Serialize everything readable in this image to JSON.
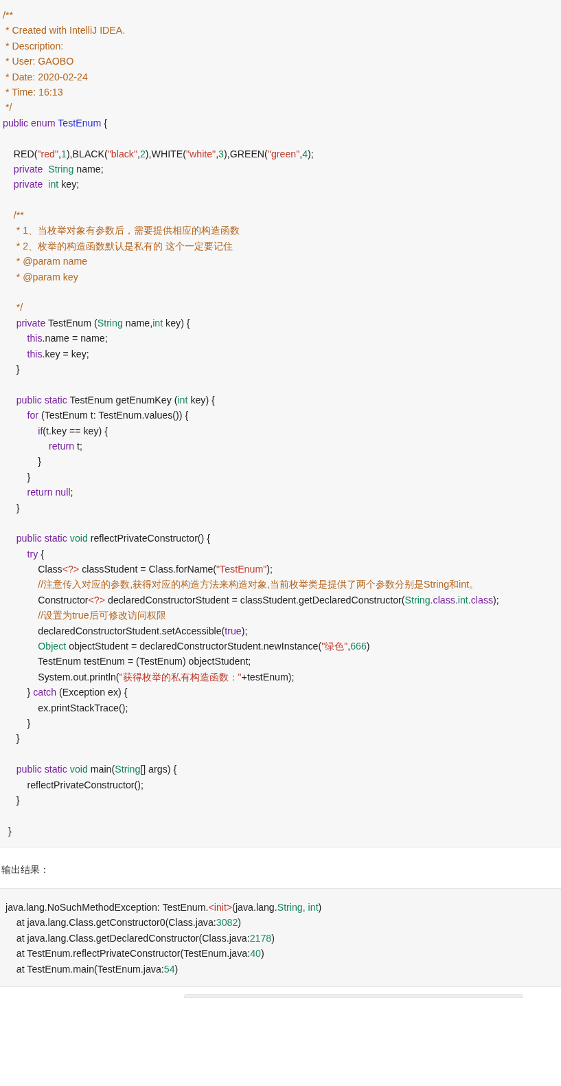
{
  "code_block": {
    "lines": [
      {
        "kind": "code",
        "tokens": [
          {
            "text": "/**",
            "kind": "comment"
          }
        ]
      },
      {
        "kind": "code",
        "tokens": [
          {
            "text": " * Created with IntelliJ IDEA.",
            "kind": "comment"
          }
        ]
      },
      {
        "kind": "code",
        "tokens": [
          {
            "text": " * Description:",
            "kind": "comment"
          }
        ]
      },
      {
        "kind": "code",
        "tokens": [
          {
            "text": " * User: GAOBO",
            "kind": "comment"
          }
        ]
      },
      {
        "kind": "code",
        "tokens": [
          {
            "text": " * Date: 2020-02-24",
            "kind": "comment"
          }
        ]
      },
      {
        "kind": "code",
        "tokens": [
          {
            "text": " * Time: 16:13",
            "kind": "comment"
          }
        ]
      },
      {
        "kind": "code",
        "tokens": [
          {
            "text": " */",
            "kind": "comment"
          }
        ]
      },
      {
        "kind": "code",
        "tokens": [
          {
            "text": "public enum ",
            "kind": "keyword"
          },
          {
            "text": "TestEnum",
            "kind": "title"
          },
          {
            "text": " {",
            "kind": "plain"
          }
        ]
      },
      {
        "kind": "blank"
      },
      {
        "kind": "code",
        "tokens": [
          {
            "text": "    RED(",
            "kind": "plain"
          },
          {
            "text": "\"red\"",
            "kind": "string"
          },
          {
            "text": ",",
            "kind": "plain"
          },
          {
            "text": "1",
            "kind": "number"
          },
          {
            "text": "),BLACK(",
            "kind": "plain"
          },
          {
            "text": "\"black\"",
            "kind": "string"
          },
          {
            "text": ",",
            "kind": "plain"
          },
          {
            "text": "2",
            "kind": "number"
          },
          {
            "text": "),WHITE(",
            "kind": "plain"
          },
          {
            "text": "\"white\"",
            "kind": "string"
          },
          {
            "text": ",",
            "kind": "plain"
          },
          {
            "text": "3",
            "kind": "number"
          },
          {
            "text": "),GREEN(",
            "kind": "plain"
          },
          {
            "text": "\"green\"",
            "kind": "string"
          },
          {
            "text": ",",
            "kind": "plain"
          },
          {
            "text": "4",
            "kind": "number"
          },
          {
            "text": ");",
            "kind": "plain"
          }
        ]
      },
      {
        "kind": "code",
        "tokens": [
          {
            "text": "    private  ",
            "kind": "keyword"
          },
          {
            "text": "String",
            "kind": "type"
          },
          {
            "text": " name;",
            "kind": "plain"
          }
        ]
      },
      {
        "kind": "code",
        "tokens": [
          {
            "text": "    private  ",
            "kind": "keyword"
          },
          {
            "text": "int",
            "kind": "type"
          },
          {
            "text": " key;",
            "kind": "plain"
          }
        ]
      },
      {
        "kind": "blank"
      },
      {
        "kind": "code",
        "tokens": [
          {
            "text": "    /**",
            "kind": "comment"
          }
        ]
      },
      {
        "kind": "code",
        "tokens": [
          {
            "text": "     * 1、当枚举对象有参数后，需要提供相应的构造函数",
            "kind": "comment"
          }
        ]
      },
      {
        "kind": "code",
        "tokens": [
          {
            "text": "     * 2、枚举的构造函数默认是私有的 这个一定要记住",
            "kind": "comment"
          }
        ]
      },
      {
        "kind": "code",
        "tokens": [
          {
            "text": "     * @param name",
            "kind": "comment"
          }
        ]
      },
      {
        "kind": "code",
        "tokens": [
          {
            "text": "     * @param key",
            "kind": "comment"
          }
        ]
      },
      {
        "kind": "blank"
      },
      {
        "kind": "code",
        "tokens": [
          {
            "text": "     */",
            "kind": "comment"
          }
        ]
      },
      {
        "kind": "code",
        "tokens": [
          {
            "text": "     private ",
            "kind": "keyword"
          },
          {
            "text": "TestEnum (",
            "kind": "plain"
          },
          {
            "text": "String",
            "kind": "type"
          },
          {
            "text": " name,",
            "kind": "plain"
          },
          {
            "text": "int",
            "kind": "type"
          },
          {
            "text": " key) {",
            "kind": "plain"
          }
        ]
      },
      {
        "kind": "code",
        "tokens": [
          {
            "text": "         this",
            "kind": "keyword"
          },
          {
            "text": ".name = name;",
            "kind": "plain"
          }
        ]
      },
      {
        "kind": "code",
        "tokens": [
          {
            "text": "         this",
            "kind": "keyword"
          },
          {
            "text": ".key = key;",
            "kind": "plain"
          }
        ]
      },
      {
        "kind": "code",
        "tokens": [
          {
            "text": "     }",
            "kind": "plain"
          }
        ]
      },
      {
        "kind": "blank"
      },
      {
        "kind": "code",
        "tokens": [
          {
            "text": "     public static ",
            "kind": "keyword"
          },
          {
            "text": "TestEnum getEnumKey (",
            "kind": "plain"
          },
          {
            "text": "int",
            "kind": "type"
          },
          {
            "text": " key) {",
            "kind": "plain"
          }
        ]
      },
      {
        "kind": "code",
        "tokens": [
          {
            "text": "         for ",
            "kind": "keyword"
          },
          {
            "text": "(TestEnum t: TestEnum.values()) {",
            "kind": "plain"
          }
        ]
      },
      {
        "kind": "code",
        "tokens": [
          {
            "text": "             if",
            "kind": "keyword"
          },
          {
            "text": "(t.key == key) {",
            "kind": "plain"
          }
        ]
      },
      {
        "kind": "code",
        "tokens": [
          {
            "text": "                 return ",
            "kind": "keyword"
          },
          {
            "text": "t;",
            "kind": "plain"
          }
        ]
      },
      {
        "kind": "code",
        "tokens": [
          {
            "text": "             }",
            "kind": "plain"
          }
        ]
      },
      {
        "kind": "code",
        "tokens": [
          {
            "text": "         }",
            "kind": "plain"
          }
        ]
      },
      {
        "kind": "code",
        "tokens": [
          {
            "text": "         return null",
            "kind": "keyword"
          },
          {
            "text": ";",
            "kind": "plain"
          }
        ]
      },
      {
        "kind": "code",
        "tokens": [
          {
            "text": "     }",
            "kind": "plain"
          }
        ]
      },
      {
        "kind": "blank"
      },
      {
        "kind": "code",
        "tokens": [
          {
            "text": "     public static ",
            "kind": "keyword"
          },
          {
            "text": "void",
            "kind": "type"
          },
          {
            "text": " reflectPrivateConstructor() {",
            "kind": "plain"
          }
        ]
      },
      {
        "kind": "code",
        "tokens": [
          {
            "text": "         try",
            "kind": "keyword"
          },
          {
            "text": " {",
            "kind": "plain"
          }
        ]
      },
      {
        "kind": "code",
        "tokens": [
          {
            "text": "             Class",
            "kind": "plain"
          },
          {
            "text": "<?>",
            "kind": "string"
          },
          {
            "text": " classStudent = Class.forName(",
            "kind": "plain"
          },
          {
            "text": "\"TestEnum\"",
            "kind": "string"
          },
          {
            "text": ");",
            "kind": "plain"
          }
        ]
      },
      {
        "kind": "code",
        "tokens": [
          {
            "text": "             //注意传入对应的参数,获得对应的构造方法来构造对象,当前枚举类是提供了两个参数分别是String和int。",
            "kind": "comment"
          }
        ]
      },
      {
        "kind": "code",
        "tokens": [
          {
            "text": "             Constructor",
            "kind": "plain"
          },
          {
            "text": "<?>",
            "kind": "string"
          },
          {
            "text": " declaredConstructorStudent = classStudent.getDeclaredConstructor(",
            "kind": "plain"
          },
          {
            "text": "String",
            "kind": "type"
          },
          {
            "text": ".class.",
            "kind": "keyword"
          },
          {
            "text": "int",
            "kind": "type"
          },
          {
            "text": ".class",
            "kind": "keyword"
          },
          {
            "text": ");",
            "kind": "plain"
          }
        ]
      },
      {
        "kind": "code",
        "tokens": [
          {
            "text": "             //设置为true后可修改访问权限",
            "kind": "comment"
          }
        ]
      },
      {
        "kind": "code",
        "tokens": [
          {
            "text": "             declaredConstructorStudent.setAccessible(",
            "kind": "plain"
          },
          {
            "text": "true",
            "kind": "keyword"
          },
          {
            "text": ");",
            "kind": "plain"
          }
        ]
      },
      {
        "kind": "code",
        "tokens": [
          {
            "text": "             Object",
            "kind": "type"
          },
          {
            "text": " objectStudent = declaredConstructorStudent.newInstance(",
            "kind": "plain"
          },
          {
            "text": "\"绿色\"",
            "kind": "string"
          },
          {
            "text": ",",
            "kind": "plain"
          },
          {
            "text": "666",
            "kind": "number"
          },
          {
            "text": ")",
            "kind": "plain"
          }
        ]
      },
      {
        "kind": "code",
        "tokens": [
          {
            "text": "             TestEnum testEnum = (TestEnum) objectStudent;",
            "kind": "plain"
          }
        ]
      },
      {
        "kind": "code",
        "tokens": [
          {
            "text": "             System.out.println(",
            "kind": "plain"
          },
          {
            "text": "\"获得枚举的私有构造函数：\"",
            "kind": "string"
          },
          {
            "text": "+testEnum);",
            "kind": "plain"
          }
        ]
      },
      {
        "kind": "code",
        "tokens": [
          {
            "text": "         } ",
            "kind": "plain"
          },
          {
            "text": "catch",
            "kind": "keyword"
          },
          {
            "text": " (Exception ex) {",
            "kind": "plain"
          }
        ]
      },
      {
        "kind": "code",
        "tokens": [
          {
            "text": "             ex.printStackTrace();",
            "kind": "plain"
          }
        ]
      },
      {
        "kind": "code",
        "tokens": [
          {
            "text": "         }",
            "kind": "plain"
          }
        ]
      },
      {
        "kind": "code",
        "tokens": [
          {
            "text": "     }",
            "kind": "plain"
          }
        ]
      },
      {
        "kind": "blank"
      },
      {
        "kind": "code",
        "tokens": [
          {
            "text": "     public static ",
            "kind": "keyword"
          },
          {
            "text": "void",
            "kind": "type"
          },
          {
            "text": " main(",
            "kind": "plain"
          },
          {
            "text": "String",
            "kind": "type"
          },
          {
            "text": "[] args) {",
            "kind": "plain"
          }
        ]
      },
      {
        "kind": "code",
        "tokens": [
          {
            "text": "         reflectPrivateConstructor();",
            "kind": "plain"
          }
        ]
      },
      {
        "kind": "code",
        "tokens": [
          {
            "text": "     }",
            "kind": "plain"
          }
        ]
      },
      {
        "kind": "blank"
      },
      {
        "kind": "code",
        "tokens": [
          {
            "text": "  }",
            "kind": "plain"
          }
        ]
      }
    ]
  },
  "output_heading": "输出结果：",
  "output_block": {
    "lines": [
      {
        "kind": "code",
        "tokens": [
          {
            "text": "java.lang.NoSuchMethodException: TestEnum.",
            "kind": "plain"
          },
          {
            "text": "<init>",
            "kind": "string"
          },
          {
            "text": "(java.lang.",
            "kind": "plain"
          },
          {
            "text": "String, int",
            "kind": "type"
          },
          {
            "text": ")",
            "kind": "plain"
          }
        ]
      },
      {
        "kind": "code",
        "tokens": [
          {
            "text": "    at java.lang.Class.getConstructor0(Class.java:",
            "kind": "plain"
          },
          {
            "text": "3082",
            "kind": "number"
          },
          {
            "text": ")",
            "kind": "plain"
          }
        ]
      },
      {
        "kind": "code",
        "tokens": [
          {
            "text": "    at java.lang.Class.getDeclaredConstructor(Class.java:",
            "kind": "plain"
          },
          {
            "text": "2178",
            "kind": "number"
          },
          {
            "text": ")",
            "kind": "plain"
          }
        ]
      },
      {
        "kind": "code",
        "tokens": [
          {
            "text": "    at TestEnum.reflectPrivateConstructor(TestEnum.java:",
            "kind": "plain"
          },
          {
            "text": "40",
            "kind": "number"
          },
          {
            "text": ")",
            "kind": "plain"
          }
        ]
      },
      {
        "kind": "code",
        "tokens": [
          {
            "text": "    at TestEnum.main(TestEnum.java:",
            "kind": "plain"
          },
          {
            "text": "54",
            "kind": "number"
          },
          {
            "text": ")",
            "kind": "plain"
          }
        ]
      }
    ]
  }
}
